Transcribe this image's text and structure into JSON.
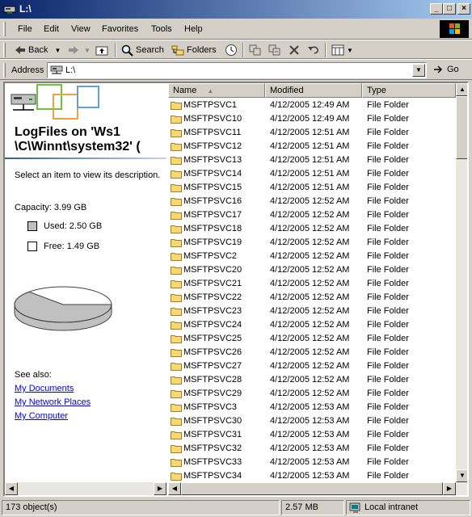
{
  "window": {
    "title": "L:\\",
    "min_label": "_",
    "max_label": "□",
    "close_label": "×"
  },
  "menu": [
    "File",
    "Edit",
    "View",
    "Favorites",
    "Tools",
    "Help"
  ],
  "toolbar": {
    "back_label": "Back",
    "search_label": "Search",
    "folders_label": "Folders"
  },
  "address": {
    "label": "Address",
    "value": "L:\\",
    "go_label": "Go"
  },
  "left_panel": {
    "title": "LogFiles on 'Ws1\n\\C\\Winnt\\system32' (",
    "description": "Select an item to view its description.",
    "capacity": "Capacity: 3.99 GB",
    "used": "Used: 2.50 GB",
    "free": "Free: 1.49 GB",
    "used_fraction": 0.627,
    "see_also": "See also:",
    "links": [
      "My Documents",
      "My Network Places",
      "My Computer"
    ]
  },
  "columns": {
    "name": "Name",
    "sort_arrow": "▲",
    "modified": "Modified",
    "type": "Type"
  },
  "files": [
    {
      "name": "MSFTPSVC1",
      "modified": "4/12/2005 12:49 AM",
      "type": "File Folder"
    },
    {
      "name": "MSFTPSVC10",
      "modified": "4/12/2005 12:49 AM",
      "type": "File Folder"
    },
    {
      "name": "MSFTPSVC11",
      "modified": "4/12/2005 12:51 AM",
      "type": "File Folder"
    },
    {
      "name": "MSFTPSVC12",
      "modified": "4/12/2005 12:51 AM",
      "type": "File Folder"
    },
    {
      "name": "MSFTPSVC13",
      "modified": "4/12/2005 12:51 AM",
      "type": "File Folder"
    },
    {
      "name": "MSFTPSVC14",
      "modified": "4/12/2005 12:51 AM",
      "type": "File Folder"
    },
    {
      "name": "MSFTPSVC15",
      "modified": "4/12/2005 12:51 AM",
      "type": "File Folder"
    },
    {
      "name": "MSFTPSVC16",
      "modified": "4/12/2005 12:52 AM",
      "type": "File Folder"
    },
    {
      "name": "MSFTPSVC17",
      "modified": "4/12/2005 12:52 AM",
      "type": "File Folder"
    },
    {
      "name": "MSFTPSVC18",
      "modified": "4/12/2005 12:52 AM",
      "type": "File Folder"
    },
    {
      "name": "MSFTPSVC19",
      "modified": "4/12/2005 12:52 AM",
      "type": "File Folder"
    },
    {
      "name": "MSFTPSVC2",
      "modified": "4/12/2005 12:52 AM",
      "type": "File Folder"
    },
    {
      "name": "MSFTPSVC20",
      "modified": "4/12/2005 12:52 AM",
      "type": "File Folder"
    },
    {
      "name": "MSFTPSVC21",
      "modified": "4/12/2005 12:52 AM",
      "type": "File Folder"
    },
    {
      "name": "MSFTPSVC22",
      "modified": "4/12/2005 12:52 AM",
      "type": "File Folder"
    },
    {
      "name": "MSFTPSVC23",
      "modified": "4/12/2005 12:52 AM",
      "type": "File Folder"
    },
    {
      "name": "MSFTPSVC24",
      "modified": "4/12/2005 12:52 AM",
      "type": "File Folder"
    },
    {
      "name": "MSFTPSVC25",
      "modified": "4/12/2005 12:52 AM",
      "type": "File Folder"
    },
    {
      "name": "MSFTPSVC26",
      "modified": "4/12/2005 12:52 AM",
      "type": "File Folder"
    },
    {
      "name": "MSFTPSVC27",
      "modified": "4/12/2005 12:52 AM",
      "type": "File Folder"
    },
    {
      "name": "MSFTPSVC28",
      "modified": "4/12/2005 12:52 AM",
      "type": "File Folder"
    },
    {
      "name": "MSFTPSVC29",
      "modified": "4/12/2005 12:52 AM",
      "type": "File Folder"
    },
    {
      "name": "MSFTPSVC3",
      "modified": "4/12/2005 12:53 AM",
      "type": "File Folder"
    },
    {
      "name": "MSFTPSVC30",
      "modified": "4/12/2005 12:53 AM",
      "type": "File Folder"
    },
    {
      "name": "MSFTPSVC31",
      "modified": "4/12/2005 12:53 AM",
      "type": "File Folder"
    },
    {
      "name": "MSFTPSVC32",
      "modified": "4/12/2005 12:53 AM",
      "type": "File Folder"
    },
    {
      "name": "MSFTPSVC33",
      "modified": "4/12/2005 12:53 AM",
      "type": "File Folder"
    },
    {
      "name": "MSFTPSVC34",
      "modified": "4/12/2005 12:53 AM",
      "type": "File Folder"
    }
  ],
  "status": {
    "objects": "173 object(s)",
    "size": "2.57 MB",
    "zone": "Local intranet"
  },
  "colors": {
    "title_start": "#0a246a",
    "title_end": "#a6caf0",
    "folder_yellow": "#f8d775",
    "link": "#0000ee"
  },
  "icons": [
    "drive-icon",
    "back-arrow-icon",
    "forward-arrow-icon",
    "up-folder-icon",
    "search-icon",
    "folders-icon",
    "history-icon",
    "move-to-icon",
    "copy-to-icon",
    "delete-icon",
    "undo-icon",
    "views-icon",
    "go-arrow-icon",
    "folder-icon",
    "network-share-icon",
    "intranet-icon"
  ]
}
